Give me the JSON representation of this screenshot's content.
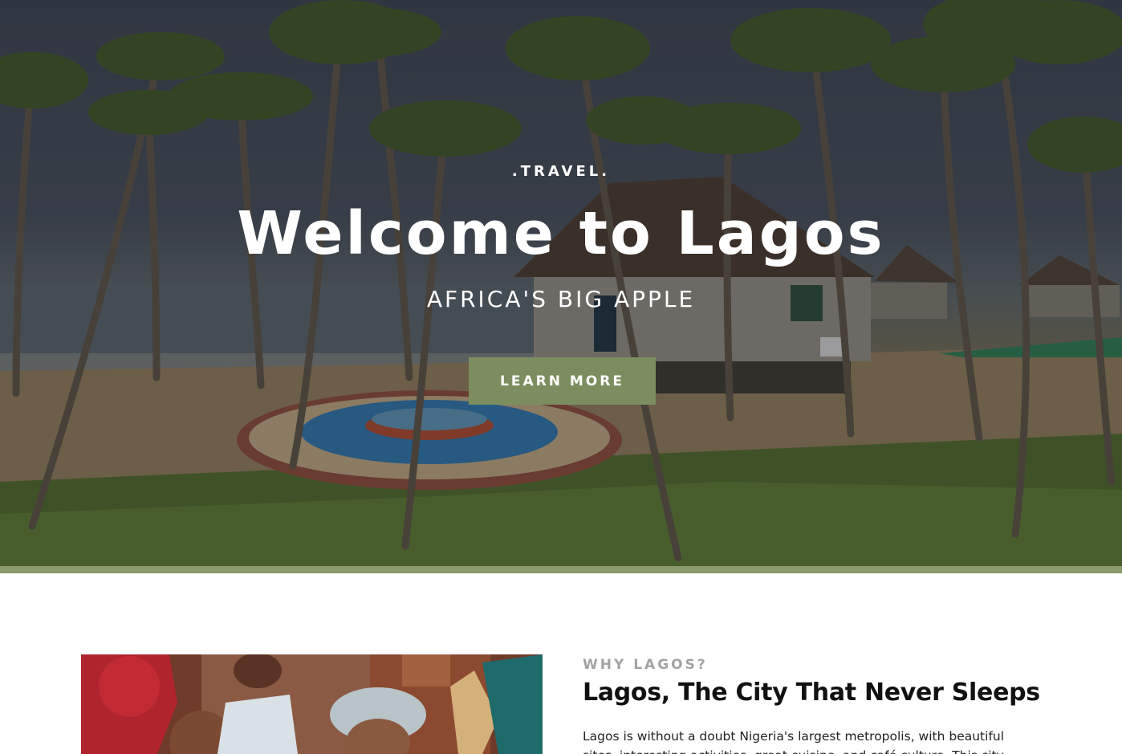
{
  "hero": {
    "eyebrow": ".TRAVEL.",
    "title": "Welcome to Lagos",
    "subtitle": "AFRICA'S BIG APPLE",
    "cta_label": "LEARN MORE",
    "accent_color": "#7c8e5f"
  },
  "about": {
    "eyebrow": "WHY LAGOS?",
    "title": "Lagos, The City That Never Sleeps",
    "body": "Lagos is without a doubt Nigeria's largest metropolis, with beautiful sites, interesting activities, great cuisine, and café culture. This city"
  },
  "icons": {
    "hero_image": "beach-resort-photo",
    "about_image": "celebration-photo"
  }
}
